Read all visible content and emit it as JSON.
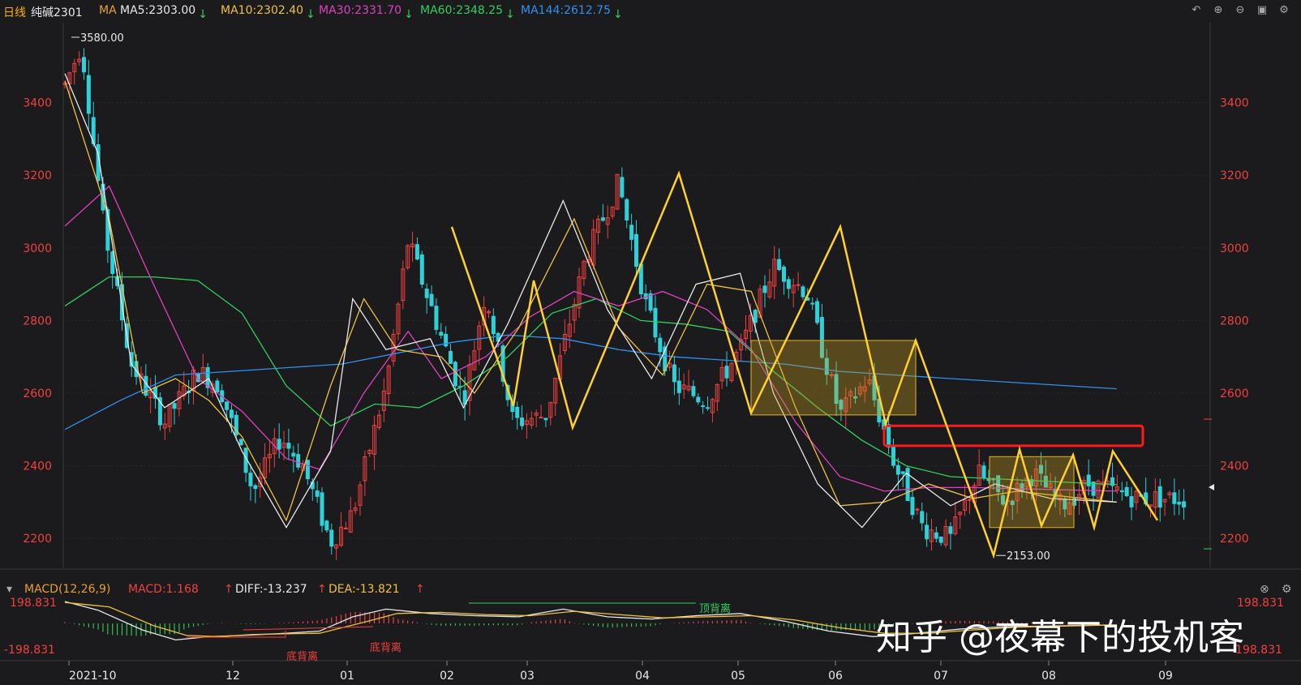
{
  "header": {
    "period": "日线",
    "symbol": "纯碱2301",
    "ma_title": "MA",
    "ma": [
      {
        "label": "MA5:2303.00",
        "color": "#e8e8e8",
        "arrow": "↓"
      },
      {
        "label": "MA10:2302.40",
        "color": "#f0c040",
        "arrow": "↓"
      },
      {
        "label": "MA30:2331.70",
        "color": "#e040c0",
        "arrow": "↓"
      },
      {
        "label": "MA60:2348.25",
        "color": "#30d060",
        "arrow": "↓"
      },
      {
        "label": "MA144:2612.75",
        "color": "#3090f0",
        "arrow": "↓"
      }
    ],
    "tools": [
      "undo-icon",
      "zoom-in-icon",
      "zoom-out-icon",
      "layout-icon",
      "settings-icon"
    ]
  },
  "macd": {
    "title": "MACD(12,26,9)",
    "macd_label": "MACD:1.168",
    "diff_label": "DIFF:-13.237",
    "dea_label": "DEA:-13.821",
    "ymax_label": "198.831",
    "ymin_label": "-198.831",
    "annotations": [
      "底背离",
      "底背离",
      "顶背离"
    ]
  },
  "watermark": "知乎 @夜幕下的投机客",
  "colors": {
    "up": "#f04040",
    "down": "#30d0d8",
    "zigzag": "#ffd030",
    "box": "#c8a020",
    "redbox": "#ff1a1a"
  },
  "chart_data": {
    "type": "candlestick",
    "ylim": [
      2120,
      3620
    ],
    "y_ticks": [
      2200,
      2400,
      2600,
      2800,
      3000,
      3200,
      3400
    ],
    "x_ticks": [
      "2021-10",
      "12",
      "01",
      "02",
      "03",
      "04",
      "05",
      "06",
      "07",
      "08",
      "09"
    ],
    "high_label": "3580.00",
    "low_label": "2153.00",
    "zigzag": [
      [
        2.5,
        3058
      ],
      [
        3.2,
        2565
      ],
      [
        3.9,
        2910
      ],
      [
        4.5,
        2505
      ],
      [
        5.6,
        3205
      ],
      [
        6.5,
        2545
      ],
      [
        7.5,
        3058
      ],
      [
        8.0,
        2515
      ],
      [
        8.4,
        2745
      ],
      [
        9.3,
        2153
      ],
      [
        9.6,
        2445
      ],
      [
        9.9,
        2235
      ],
      [
        10.2,
        2430
      ],
      [
        10.5,
        2230
      ],
      [
        10.7,
        2440
      ],
      [
        11.0,
        2250
      ]
    ],
    "ma5": [
      [
        0,
        3480
      ],
      [
        0.3,
        3260
      ],
      [
        0.6,
        2680
      ],
      [
        0.9,
        2560
      ],
      [
        1.3,
        2640
      ],
      [
        1.6,
        2440
      ],
      [
        2.0,
        2230
      ],
      [
        2.4,
        2440
      ],
      [
        2.6,
        2860
      ],
      [
        2.9,
        2720
      ],
      [
        3.3,
        2750
      ],
      [
        3.6,
        2560
      ],
      [
        4.0,
        2790
      ],
      [
        4.5,
        3130
      ],
      [
        4.9,
        2830
      ],
      [
        5.3,
        2640
      ],
      [
        5.7,
        2900
      ],
      [
        6.1,
        2930
      ],
      [
        6.4,
        2600
      ],
      [
        6.8,
        2350
      ],
      [
        7.2,
        2230
      ],
      [
        7.6,
        2380
      ],
      [
        8.0,
        2290
      ],
      [
        8.4,
        2350
      ],
      [
        8.9,
        2310
      ],
      [
        9.5,
        2300
      ]
    ],
    "ma10": [
      [
        0,
        3460
      ],
      [
        0.4,
        3080
      ],
      [
        0.7,
        2600
      ],
      [
        1.0,
        2640
      ],
      [
        1.3,
        2580
      ],
      [
        1.6,
        2480
      ],
      [
        2.0,
        2250
      ],
      [
        2.4,
        2620
      ],
      [
        2.7,
        2860
      ],
      [
        3.0,
        2720
      ],
      [
        3.4,
        2700
      ],
      [
        3.7,
        2600
      ],
      [
        4.1,
        2780
      ],
      [
        4.6,
        3080
      ],
      [
        5.0,
        2780
      ],
      [
        5.4,
        2650
      ],
      [
        5.8,
        2900
      ],
      [
        6.2,
        2880
      ],
      [
        6.6,
        2560
      ],
      [
        7.0,
        2290
      ],
      [
        7.4,
        2300
      ],
      [
        7.8,
        2350
      ],
      [
        8.2,
        2310
      ],
      [
        8.6,
        2330
      ],
      [
        9.5,
        2300
      ]
    ],
    "ma30": [
      [
        0,
        3060
      ],
      [
        0.4,
        3170
      ],
      [
        0.8,
        2900
      ],
      [
        1.2,
        2640
      ],
      [
        1.6,
        2550
      ],
      [
        2.0,
        2420
      ],
      [
        2.3,
        2390
      ],
      [
        2.7,
        2600
      ],
      [
        3.1,
        2770
      ],
      [
        3.4,
        2640
      ],
      [
        3.8,
        2700
      ],
      [
        4.2,
        2810
      ],
      [
        4.6,
        2880
      ],
      [
        5.0,
        2840
      ],
      [
        5.4,
        2880
      ],
      [
        5.8,
        2830
      ],
      [
        6.2,
        2720
      ],
      [
        6.6,
        2520
      ],
      [
        7.0,
        2370
      ],
      [
        7.4,
        2330
      ],
      [
        7.8,
        2340
      ],
      [
        8.2,
        2340
      ],
      [
        9.5,
        2330
      ]
    ],
    "ma60": [
      [
        0,
        2840
      ],
      [
        0.4,
        2920
      ],
      [
        0.8,
        2920
      ],
      [
        1.2,
        2910
      ],
      [
        1.6,
        2820
      ],
      [
        2.0,
        2620
      ],
      [
        2.4,
        2510
      ],
      [
        2.8,
        2570
      ],
      [
        3.2,
        2560
      ],
      [
        3.6,
        2620
      ],
      [
        4.0,
        2700
      ],
      [
        4.4,
        2820
      ],
      [
        4.8,
        2860
      ],
      [
        5.2,
        2800
      ],
      [
        5.6,
        2790
      ],
      [
        6.0,
        2770
      ],
      [
        6.4,
        2660
      ],
      [
        6.8,
        2560
      ],
      [
        7.2,
        2470
      ],
      [
        7.6,
        2400
      ],
      [
        8.0,
        2370
      ],
      [
        9.5,
        2348
      ]
    ],
    "ma144": [
      [
        0,
        2500
      ],
      [
        0.5,
        2580
      ],
      [
        1.0,
        2650
      ],
      [
        1.5,
        2660
      ],
      [
        2.0,
        2670
      ],
      [
        2.5,
        2680
      ],
      [
        3.0,
        2710
      ],
      [
        3.5,
        2740
      ],
      [
        4.0,
        2760
      ],
      [
        4.5,
        2750
      ],
      [
        5.0,
        2720
      ],
      [
        5.5,
        2700
      ],
      [
        6.0,
        2690
      ],
      [
        6.5,
        2680
      ],
      [
        7.0,
        2660
      ],
      [
        7.5,
        2650
      ],
      [
        8.0,
        2640
      ],
      [
        9.5,
        2612
      ]
    ],
    "macd_diff": [
      [
        0,
        199
      ],
      [
        0.3,
        120
      ],
      [
        0.7,
        -60
      ],
      [
        1.0,
        -150
      ],
      [
        1.3,
        -120
      ],
      [
        1.6,
        -110
      ],
      [
        2.0,
        -90
      ],
      [
        2.3,
        -70
      ],
      [
        2.6,
        60
      ],
      [
        2.9,
        130
      ],
      [
        3.3,
        90
      ],
      [
        3.7,
        70
      ],
      [
        4.1,
        60
      ],
      [
        4.5,
        130
      ],
      [
        4.9,
        60
      ],
      [
        5.3,
        40
      ],
      [
        5.7,
        70
      ],
      [
        6.1,
        90
      ],
      [
        6.5,
        20
      ],
      [
        6.9,
        -70
      ],
      [
        7.3,
        -120
      ],
      [
        7.7,
        -90
      ],
      [
        8.1,
        -50
      ],
      [
        8.5,
        -30
      ],
      [
        9.5,
        -13
      ]
    ],
    "macd_dea": [
      [
        0,
        190
      ],
      [
        0.4,
        150
      ],
      [
        0.8,
        -20
      ],
      [
        1.1,
        -110
      ],
      [
        1.4,
        -120
      ],
      [
        1.7,
        -100
      ],
      [
        2.0,
        -95
      ],
      [
        2.3,
        -90
      ],
      [
        2.7,
        10
      ],
      [
        3.0,
        90
      ],
      [
        3.4,
        100
      ],
      [
        3.8,
        80
      ],
      [
        4.2,
        70
      ],
      [
        4.6,
        110
      ],
      [
        5.0,
        80
      ],
      [
        5.4,
        50
      ],
      [
        5.8,
        60
      ],
      [
        6.2,
        70
      ],
      [
        6.6,
        30
      ],
      [
        7.0,
        -40
      ],
      [
        7.4,
        -90
      ],
      [
        7.8,
        -90
      ],
      [
        8.2,
        -60
      ],
      [
        8.6,
        -35
      ],
      [
        9.5,
        -14
      ]
    ]
  }
}
